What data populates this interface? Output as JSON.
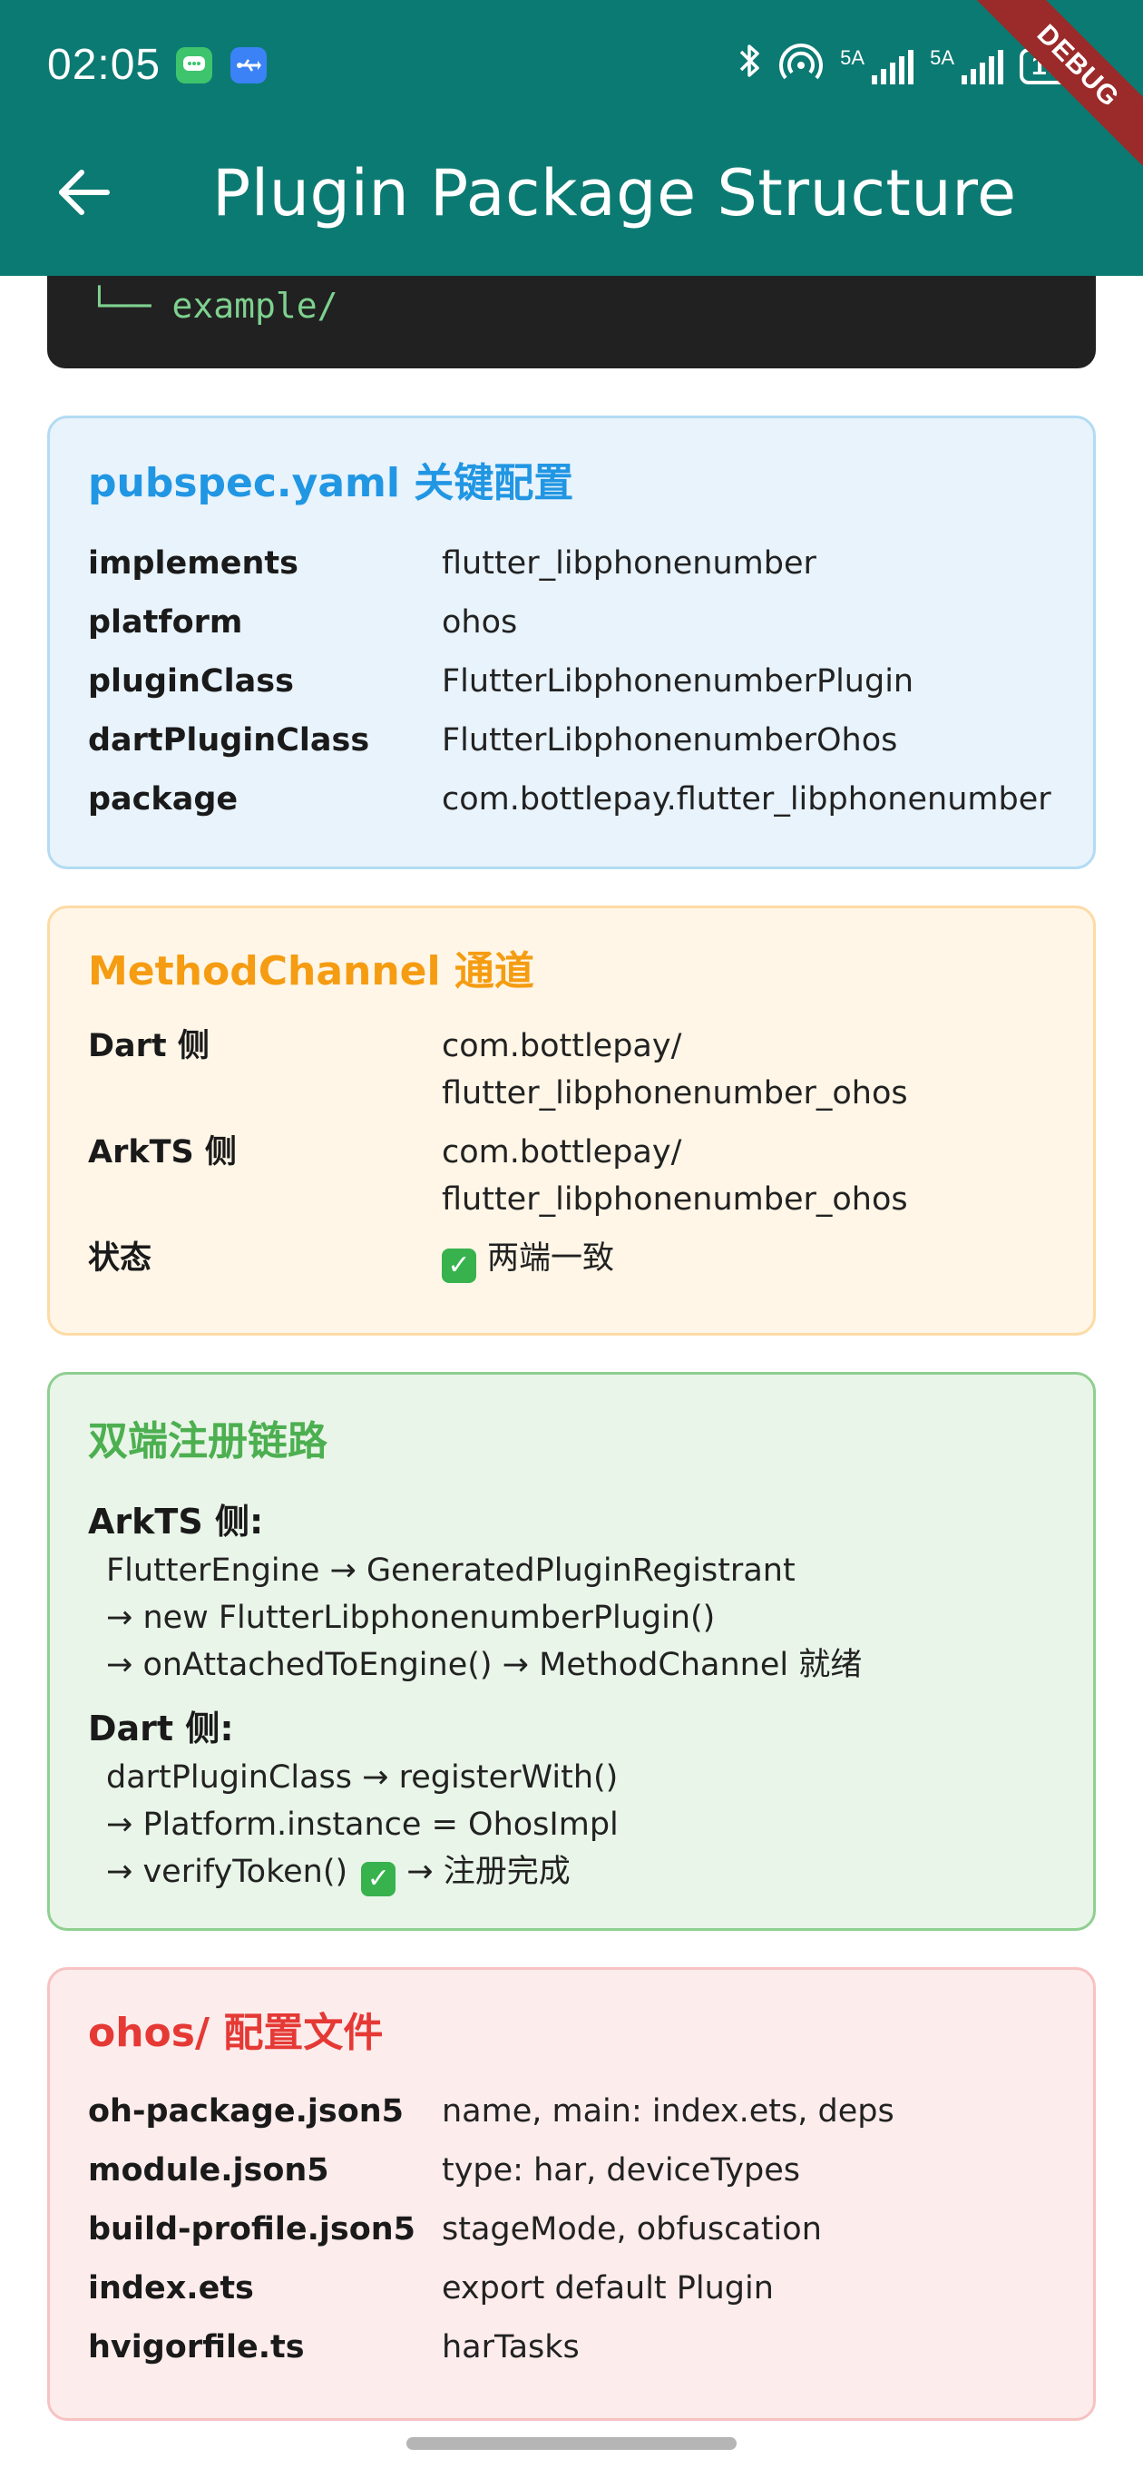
{
  "status_bar": {
    "time": "02:05",
    "signal1_label": "5A",
    "signal2_label": "5A",
    "battery": "100"
  },
  "debug_banner": "DEBUG",
  "app_bar": {
    "title": "Plugin Package Structure"
  },
  "code_block": {
    "line": "└── example/"
  },
  "pubspec_card": {
    "title": "pubspec.yaml 关键配置",
    "rows": [
      {
        "key": "implements",
        "value": "flutter_libphonenumber"
      },
      {
        "key": "platform",
        "value": "ohos"
      },
      {
        "key": "pluginClass",
        "value": "FlutterLibphonenumberPlugin"
      },
      {
        "key": "dartPluginClass",
        "value": "FlutterLibphonenumberOhos"
      },
      {
        "key": "package",
        "value": "com.bottlepay.flutter_libphonenumber"
      }
    ]
  },
  "channel_card": {
    "title": "MethodChannel 通道",
    "rows": [
      {
        "key": "Dart 侧",
        "value": "com.bottlepay/\nflutter_libphonenumber_ohos"
      },
      {
        "key": "ArkTS 侧",
        "value": "com.bottlepay/\nflutter_libphonenumber_ohos"
      },
      {
        "key": "状态",
        "value": "两端一致"
      }
    ]
  },
  "registration_card": {
    "title": "双端注册链路",
    "arkts_title": "ArkTS 侧:",
    "arkts_lines": [
      "FlutterEngine → GeneratedPluginRegistrant",
      "→ new FlutterLibphonenumberPlugin()",
      "→ onAttachedToEngine() → MethodChannel 就绪"
    ],
    "dart_title": "Dart 侧:",
    "dart_lines": [
      "dartPluginClass → registerWith()",
      "→ Platform.instance = OhosImpl",
      "→ verifyToken()",
      "→ 注册完成"
    ]
  },
  "ohos_card": {
    "title": "ohos/ 配置文件",
    "rows": [
      {
        "key": "oh-package.json5",
        "value": "name, main: index.ets, deps"
      },
      {
        "key": "module.json5",
        "value": "type: har, deviceTypes"
      },
      {
        "key": "build-profile.json5",
        "value": "stageMode, obfuscation"
      },
      {
        "key": "index.ets",
        "value": "export default Plugin"
      },
      {
        "key": "hvigorfile.ts",
        "value": "harTasks"
      }
    ]
  },
  "colors": {
    "app_bar": "#0b7a72",
    "blue_title": "#2196e3",
    "orange_title": "#f59c12",
    "green_title": "#4caf50",
    "red_title": "#e53935"
  },
  "icons": [
    "message-icon",
    "usb-icon",
    "bluetooth-icon",
    "hotspot-icon",
    "back-arrow-icon",
    "check-icon"
  ]
}
